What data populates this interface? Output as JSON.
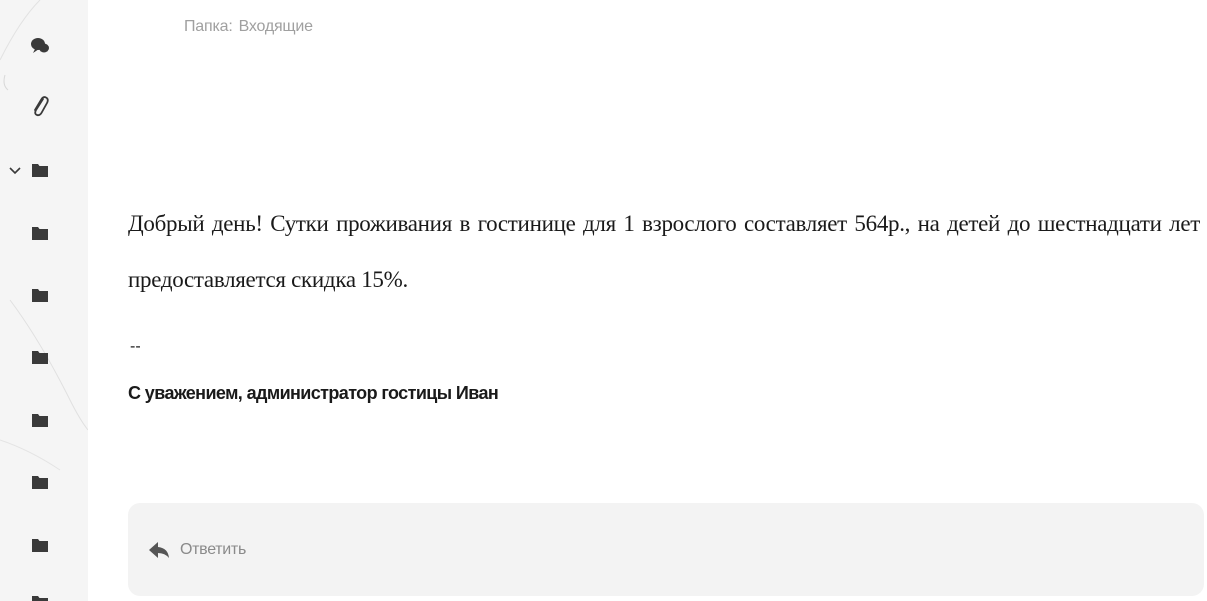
{
  "folder": {
    "label": "Папка:",
    "name": "Входящие"
  },
  "message": {
    "body": "Добрый день! Сутки проживания в гостинице для 1 взрослого составляет 564р., на детей до шестнадцати лет предоставляется скидка 15%.",
    "signature_separator": "--",
    "signature": "С уважением, администратор гостицы Иван"
  },
  "reply": {
    "label": "Ответить"
  },
  "sidebar": {
    "items": [
      {
        "icon": "chat-icon"
      },
      {
        "icon": "attachment-icon"
      },
      {
        "icon": "folder-icon",
        "expandable": true
      },
      {
        "icon": "folder-icon"
      },
      {
        "icon": "folder-icon"
      },
      {
        "icon": "folder-icon"
      },
      {
        "icon": "folder-icon"
      },
      {
        "icon": "folder-icon"
      },
      {
        "icon": "folder-icon"
      }
    ]
  },
  "colors": {
    "icon": "#3a3a3a",
    "muted_text": "#a0a0a0",
    "reply_bg": "#f3f3f3",
    "sidebar_bg": "#f5f5f5"
  }
}
